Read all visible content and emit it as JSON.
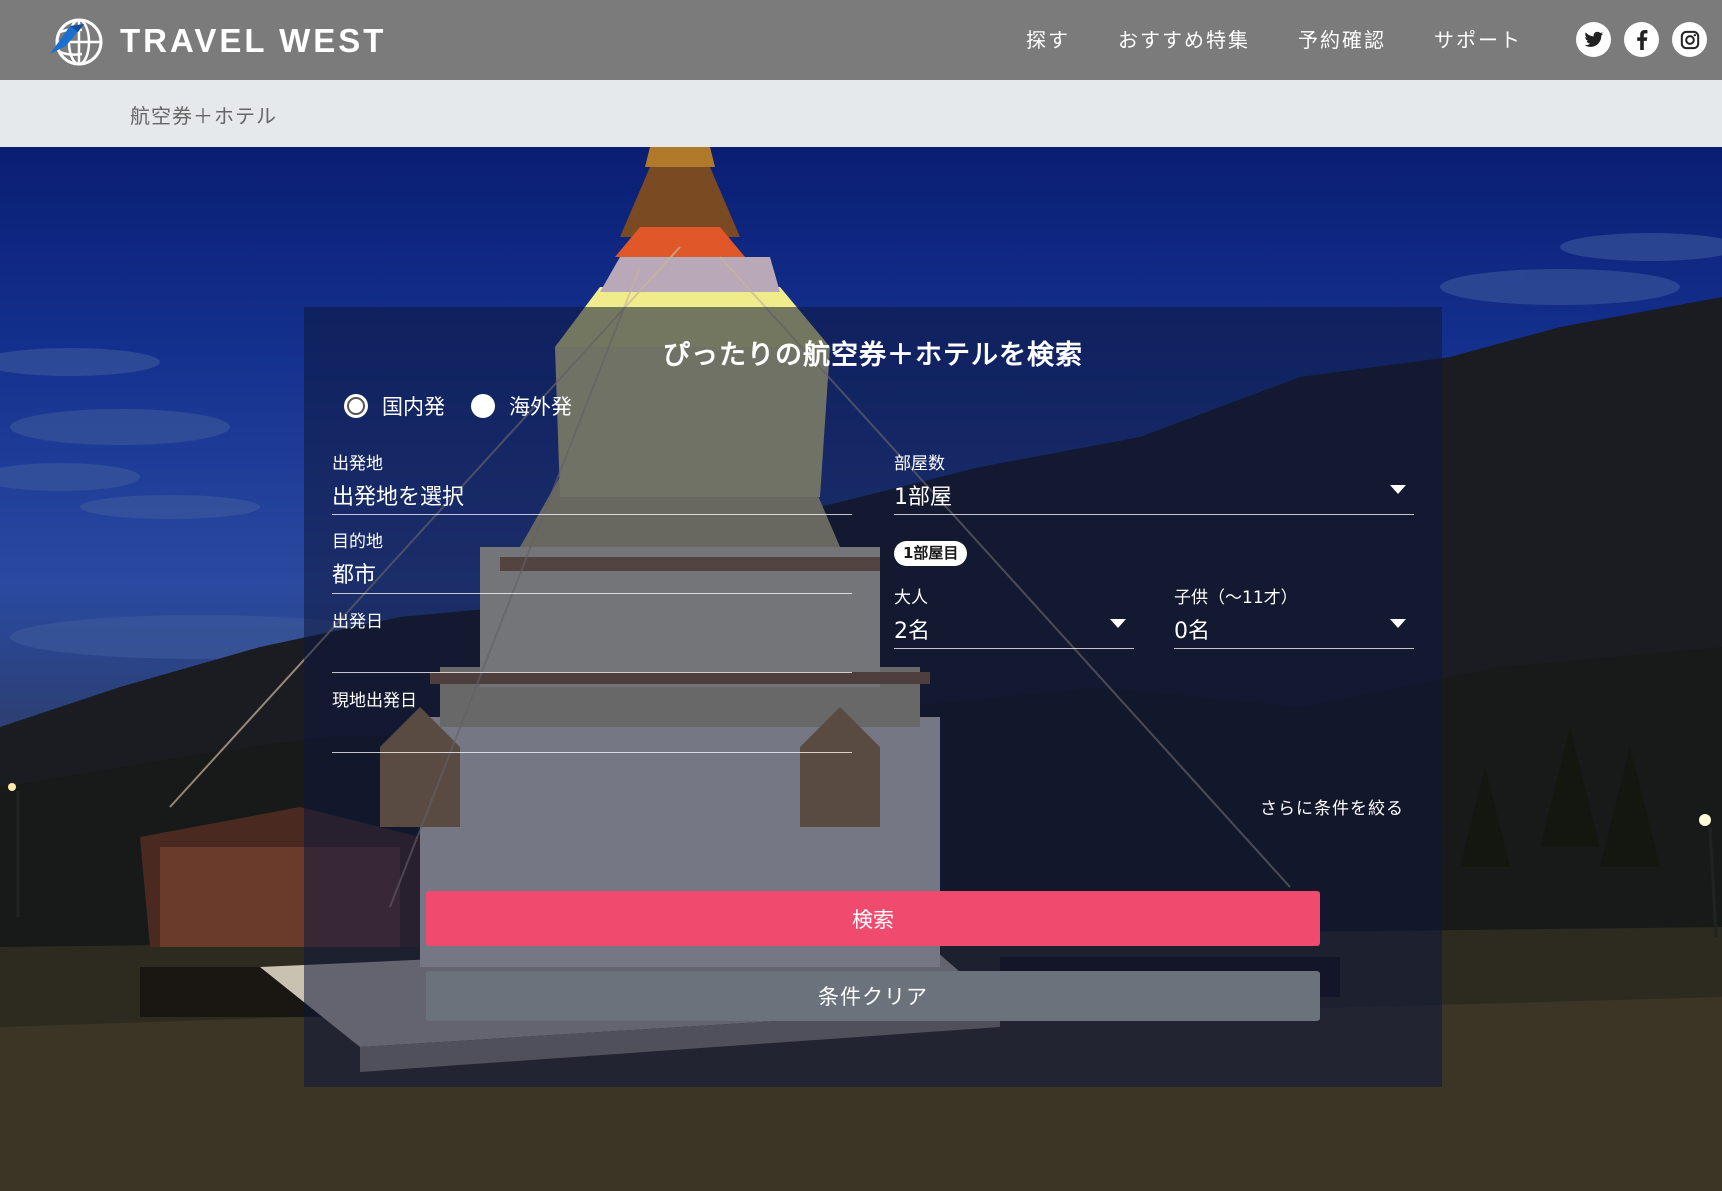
{
  "header": {
    "brand": "TRAVEL WEST",
    "nav": [
      "探す",
      "おすすめ特集",
      "予約確認",
      "サポート"
    ],
    "social": [
      "twitter-icon",
      "facebook-icon",
      "instagram-icon"
    ]
  },
  "breadcrumb": "航空券＋ホテル",
  "search": {
    "title": "ぴったりの航空券＋ホテルを検索",
    "origin_options": [
      "国内発",
      "海外発"
    ],
    "departure": {
      "label": "出発地",
      "value": "出発地を選択"
    },
    "destination": {
      "label": "目的地",
      "value": "都市"
    },
    "depart_date": {
      "label": "出発日",
      "value": ""
    },
    "local_depart_date": {
      "label": "現地出発日",
      "value": ""
    },
    "rooms": {
      "label": "部屋数",
      "value": "1部屋"
    },
    "room_badge": "1部屋目",
    "adults": {
      "label": "大人",
      "value": "2名"
    },
    "children": {
      "label": "子供（〜11才）",
      "value": "0名"
    },
    "more_conditions": "さらに条件を絞る",
    "search_button": "検索",
    "clear_button": "条件クリア"
  },
  "colors": {
    "header_bg": "#7b7b7b",
    "search_button": "#f04b6e",
    "clear_button": "#6b727c"
  }
}
